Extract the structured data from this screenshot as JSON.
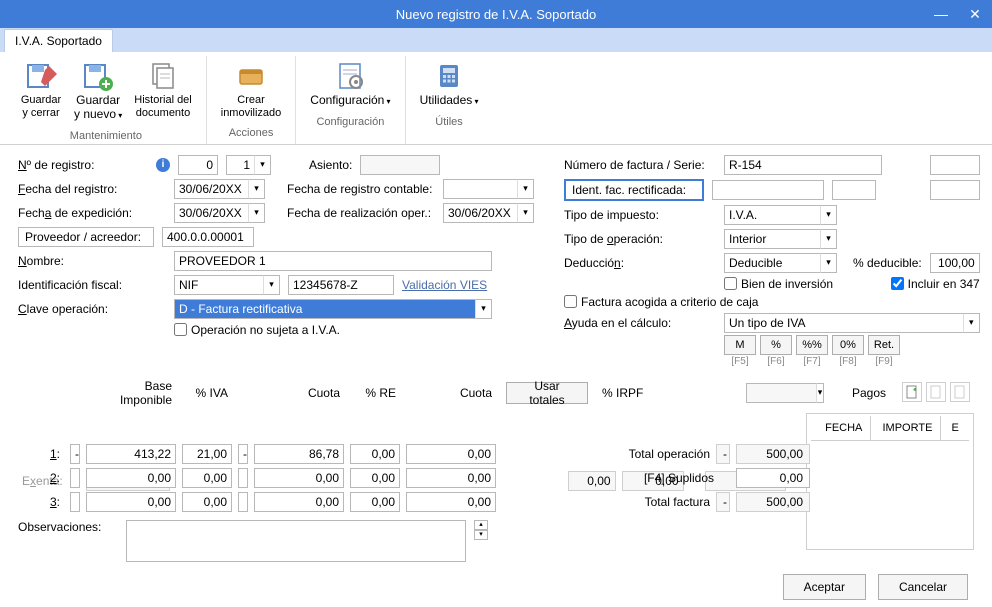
{
  "window": {
    "title": "Nuevo registro de I.V.A. Soportado"
  },
  "tab": {
    "label": "I.V.A. Soportado"
  },
  "ribbon": {
    "save_close": "Guardar\ny cerrar",
    "save_new": "Guardar\ny nuevo",
    "doc_history": "Historial del\ndocumento",
    "create_asset": "Crear\ninmovilizado",
    "config": "Configuración",
    "utils": "Utilidades",
    "grp_mant": "Mantenimiento",
    "grp_acc": "Acciones",
    "grp_conf": "Configuración",
    "grp_util": "Útiles"
  },
  "labels": {
    "nregistro": "Nº de registro:",
    "asiento": "Asiento:",
    "fecha_reg": "Fecha del registro:",
    "fecha_reg_cont": "Fecha de registro contable:",
    "fecha_exp": "Fecha de expedición:",
    "fecha_real": "Fecha de realización oper.:",
    "prov": "Proveedor / acreedor:",
    "nombre": "Nombre:",
    "ident_fiscal": "Identificación fiscal:",
    "valid_vies": "Validación VIES",
    "clave_op": "Clave operación:",
    "op_no_sujeta": "Operación no sujeta a I.V.A.",
    "num_fact": "Número de factura / Serie:",
    "ident_rect": "Ident. fac. rectificada:",
    "tipo_imp": "Tipo de impuesto:",
    "tipo_op": "Tipo de operación:",
    "deduccion": "Deducción:",
    "pct_deducible": "% deducible:",
    "bien_inv": "Bien de inversión",
    "incluir347": "Incluir en 347",
    "fact_caja": "Factura acogida a criterio de caja",
    "ayuda_calc": "Ayuda en el cálculo:",
    "observ": "Observaciones:",
    "pagos": "Pagos",
    "exenta": "Exenta:",
    "r1": "1:",
    "r2": "2:",
    "r3": "3:",
    "base_imp": "Base Imponible",
    "pct_iva": "% IVA",
    "cuota": "Cuota",
    "pct_re": "% RE",
    "cuota2": "Cuota",
    "usar_totales": "Usar totales",
    "pct_irpf": "% IRPF",
    "total_op": "Total operación",
    "f4_supl": "[F4] Suplidos",
    "total_fact": "Total factura",
    "fecha_col": "FECHA",
    "importe_col": "IMPORTE",
    "e_col": "E",
    "aceptar": "Aceptar",
    "cancelar": "Cancelar"
  },
  "calc": {
    "m": "M",
    "pct": "%",
    "pctpct": "%%",
    "zero": "0%",
    "ret": "Ret.",
    "f5": "[F5]",
    "f6": "[F6]",
    "f7": "[F7]",
    "f8": "[F8]",
    "f9": "[F9]"
  },
  "values": {
    "nreg_a": "0",
    "nreg_b": "1",
    "asiento": "",
    "fecha_reg": "30/06/20XX",
    "fecha_reg_cont": "",
    "fecha_exp": "30/06/20XX",
    "fecha_real": "30/06/20XX",
    "prov": "400.0.0.00001",
    "nombre": "PROVEEDOR 1",
    "id_tipo": "NIF",
    "id_num": "12345678-Z",
    "clave": "D - Factura rectificativa",
    "op_no_sujeta": false,
    "num_fact": "R-154",
    "ident_rect_a": "",
    "ident_rect_b": "",
    "ident_rect_c": "",
    "tipo_imp": "I.V.A.",
    "tipo_op": "Interior",
    "deduccion": "Deducible",
    "pct_deducible": "100,00",
    "bien_inv": false,
    "incluir347": true,
    "fact_caja": false,
    "ayuda": "Un tipo de IVA",
    "exenta_base": "0,00",
    "rows": [
      {
        "neg": "-",
        "base": "413,22",
        "piva": "21,00",
        "cneg": "-",
        "cuota": "86,78",
        "pre": "0,00",
        "cuota2": "0,00"
      },
      {
        "neg": "",
        "base": "0,00",
        "piva": "0,00",
        "cneg": "",
        "cuota": "0,00",
        "pre": "0,00",
        "cuota2": "0,00"
      },
      {
        "neg": "",
        "base": "0,00",
        "piva": "0,00",
        "cneg": "",
        "cuota": "0,00",
        "pre": "0,00",
        "cuota2": "0,00"
      }
    ],
    "irpf_pct": "0,00",
    "irpf_cuota": "0,00",
    "irpf_base": "0,00",
    "irpf_sel": "",
    "total_op_neg": "-",
    "total_op": "500,00",
    "suplidos": "0,00",
    "total_fact_neg": "-",
    "total_fact": "500,00",
    "observ": ""
  }
}
